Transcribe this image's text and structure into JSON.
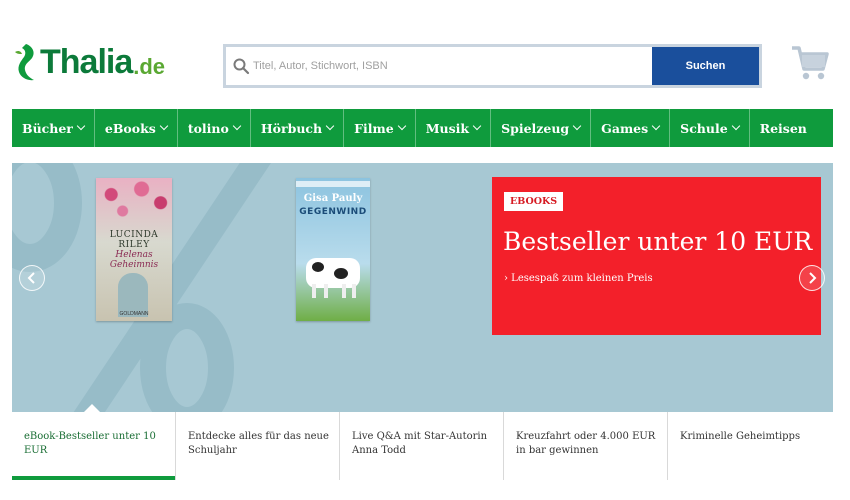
{
  "header": {
    "logo_text": "Thalia",
    "logo_tld": ".de",
    "search_placeholder": "Titel, Autor, Stichwort, ISBN",
    "search_button": "Suchen"
  },
  "nav": [
    {
      "label": "Bücher",
      "dropdown": true
    },
    {
      "label": "eBooks",
      "dropdown": true
    },
    {
      "label": "tolino",
      "dropdown": true
    },
    {
      "label": "Hörbuch",
      "dropdown": true
    },
    {
      "label": "Filme",
      "dropdown": true
    },
    {
      "label": "Musik",
      "dropdown": true
    },
    {
      "label": "Spielzeug",
      "dropdown": true
    },
    {
      "label": "Games",
      "dropdown": true
    },
    {
      "label": "Schule",
      "dropdown": true
    },
    {
      "label": "Reisen",
      "dropdown": false
    }
  ],
  "hero": {
    "book1": {
      "author": "LUCINDA RILEY",
      "title": "Helenas Geheimnis",
      "publisher": "GOLDMANN"
    },
    "book2": {
      "author": "Gisa Pauly",
      "title": "GEGENWIND"
    },
    "promo": {
      "badge": "EBOOKS",
      "title": "Bestseller unter 10 EUR",
      "subtitle": "› Lesespaß zum kleinen Preis"
    }
  },
  "tabs": [
    {
      "label": "eBook-Bestseller unter 10 EUR",
      "active": true
    },
    {
      "label": "Entdecke alles für das neue Schuljahr",
      "active": false
    },
    {
      "label": "Live Q&A mit Star-Autorin Anna Todd",
      "active": false
    },
    {
      "label": "Kreuzfahrt oder 4.000 EUR in bar gewinnen",
      "active": false
    },
    {
      "label": "Kriminelle Geheimtipps",
      "active": false
    }
  ],
  "colors": {
    "brand_green": "#0f9b3d",
    "search_blue": "#1a4f9c",
    "promo_red": "#f3202a",
    "hero_bg": "#a7c8d3"
  }
}
